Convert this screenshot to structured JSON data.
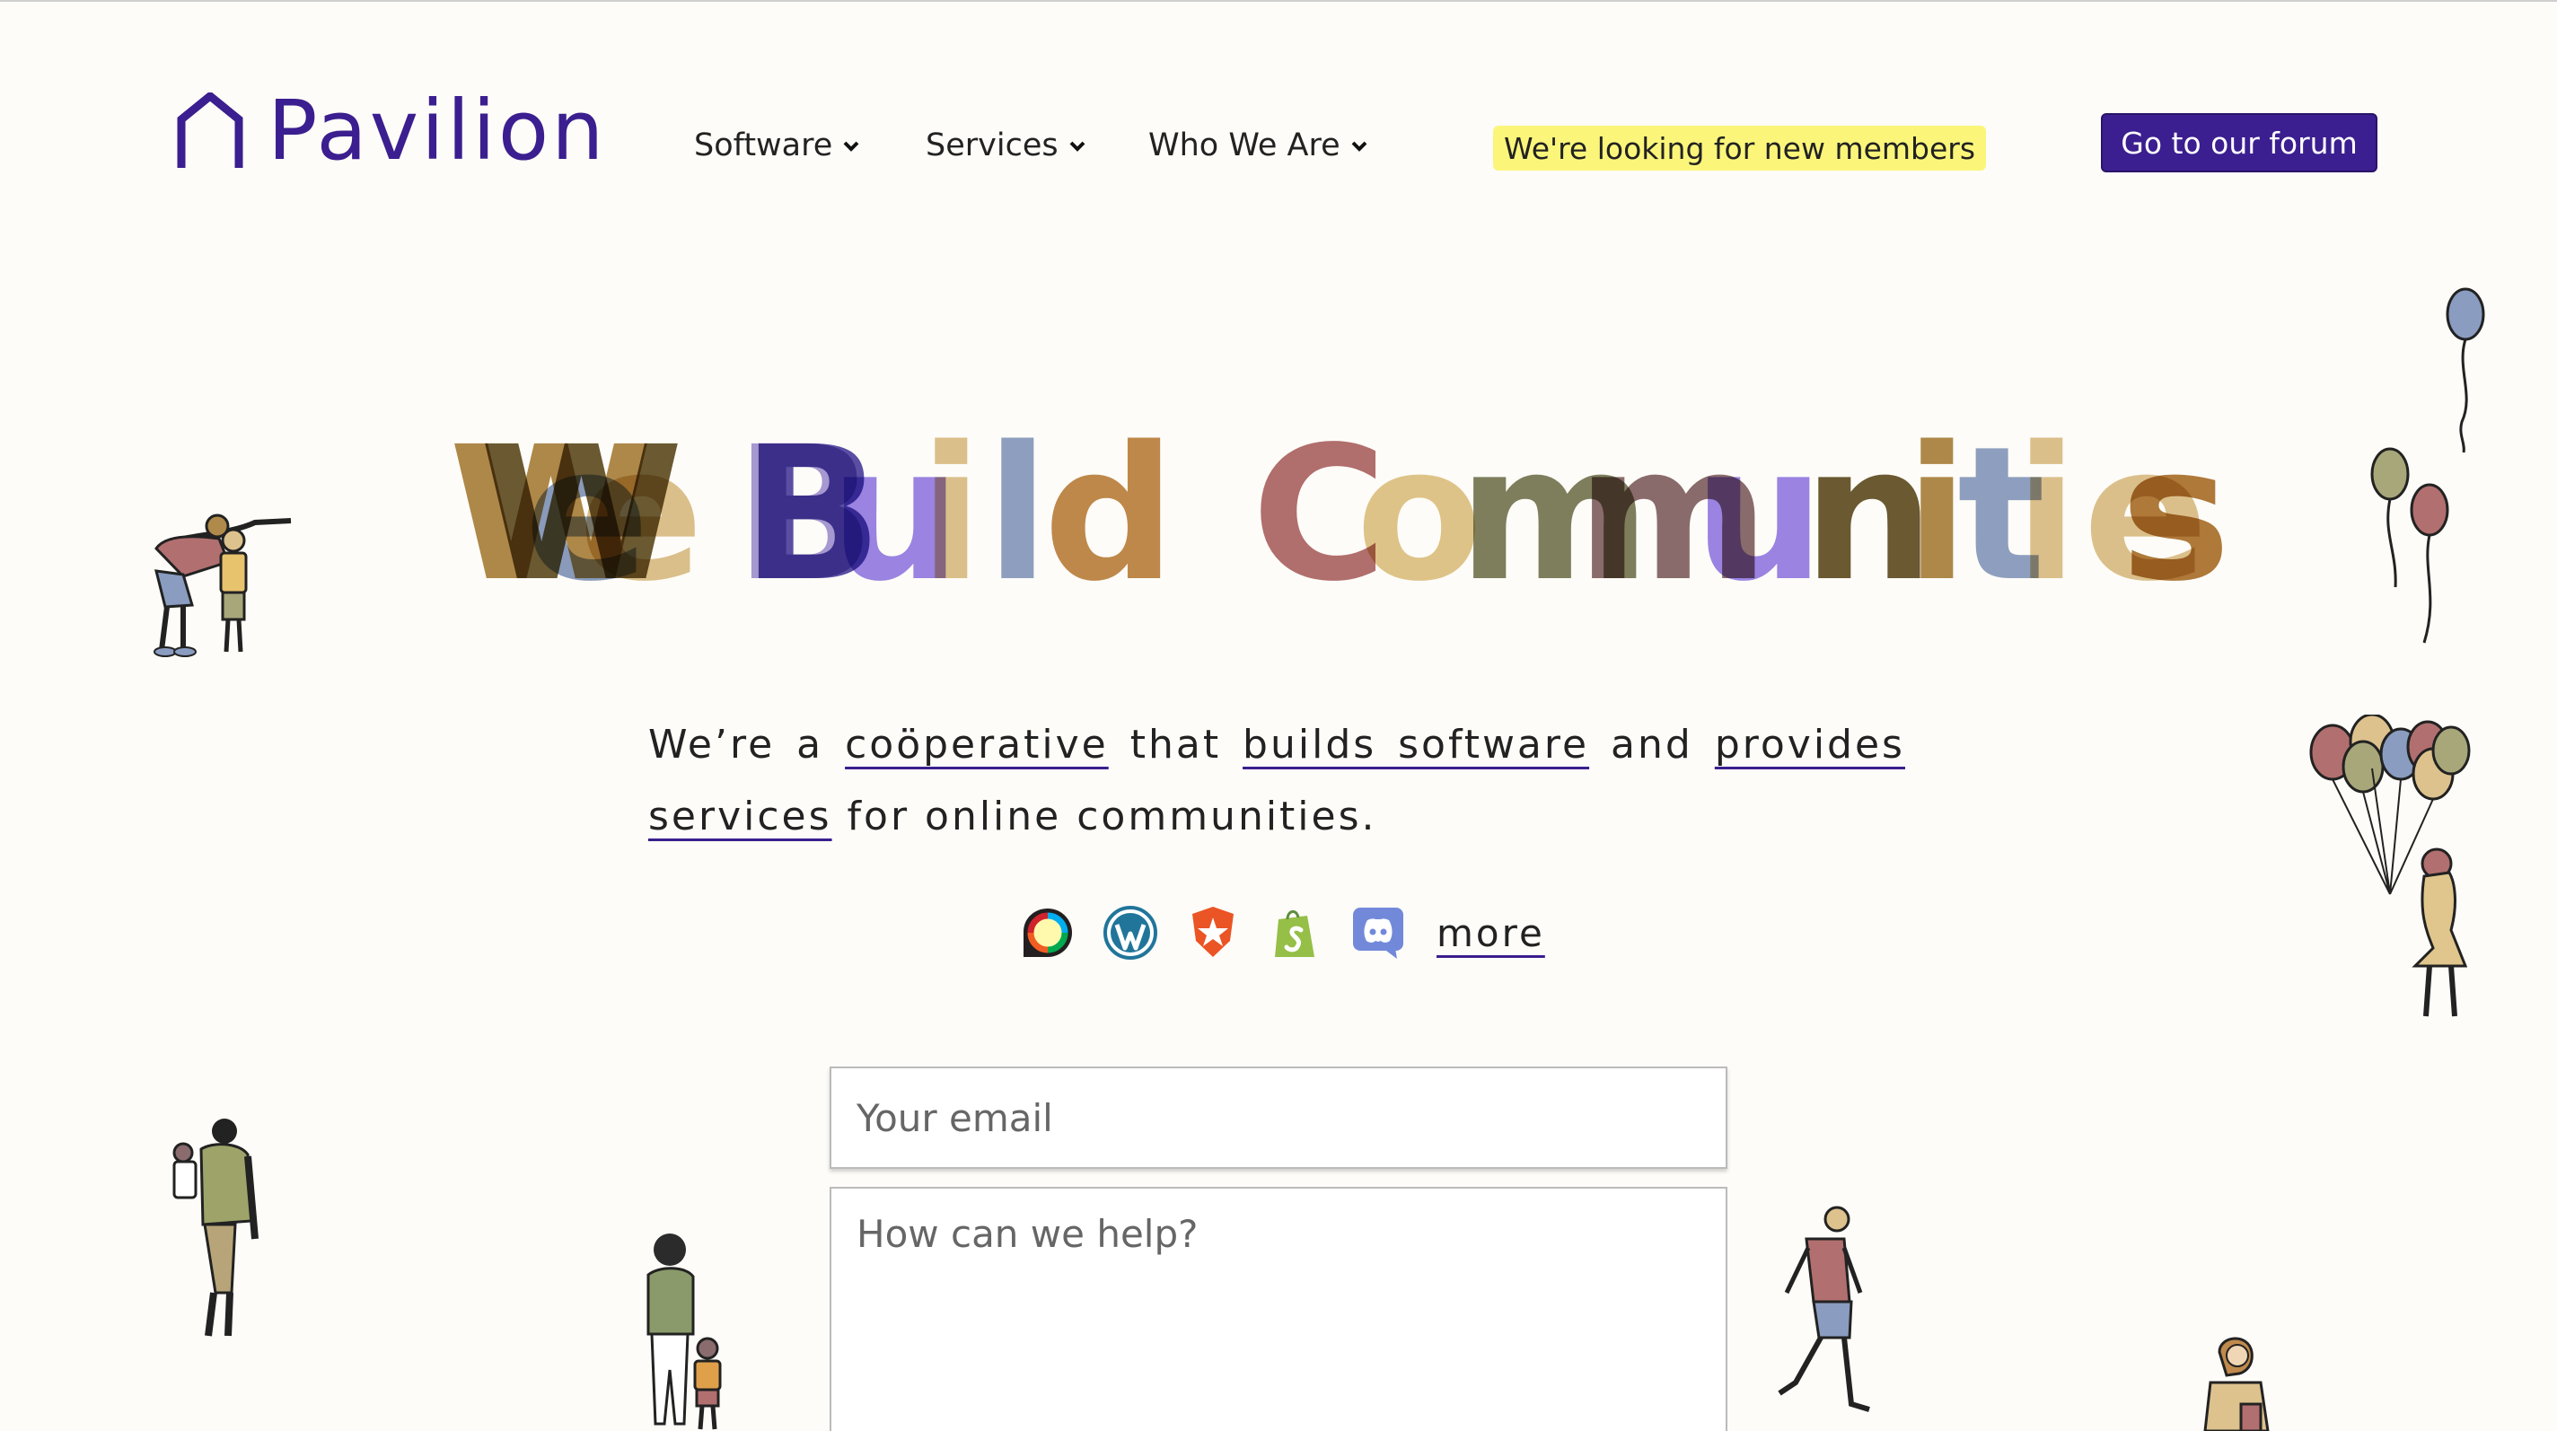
{
  "brand": {
    "name": "Pavilion",
    "color": "#3b1e8f"
  },
  "nav": [
    {
      "label": "Software"
    },
    {
      "label": "Services"
    },
    {
      "label": "Who We Are"
    }
  ],
  "badge": {
    "label": "We're looking for new members",
    "color": "#fbf67a"
  },
  "forum_button": {
    "label": "Go to our forum"
  },
  "headline": {
    "text": "We Build Communities",
    "letters": [
      {
        "ch": "W",
        "color": "#b08a4a"
      },
      {
        "ch": "W",
        "color": "#6b5a32"
      },
      {
        "ch": "e",
        "color": "#8a9cc0"
      },
      {
        "ch": "e",
        "color": "#ddc28e"
      },
      {
        "ch": "B",
        "color": "#a79ad6"
      },
      {
        "ch": "B",
        "color": "#5a4fa8"
      },
      {
        "ch": "u",
        "color": "#9b85e8"
      },
      {
        "ch": "i",
        "color": "#ddc28e"
      },
      {
        "ch": "l",
        "color": "#8fa0c4"
      },
      {
        "ch": "d",
        "color": "#c08a4c"
      },
      {
        "ch": "C",
        "color": "#b26f6f"
      },
      {
        "ch": "o",
        "color": "#e0c68c"
      },
      {
        "ch": "m",
        "color": "#7f8060"
      },
      {
        "ch": "m",
        "color": "#8a6c6e"
      },
      {
        "ch": "u",
        "color": "#9b85e8"
      },
      {
        "ch": "n",
        "color": "#6b5a32"
      },
      {
        "ch": "i",
        "color": "#b08a4a"
      },
      {
        "ch": "t",
        "color": "#8fa0c4"
      },
      {
        "ch": "i",
        "color": "#ddc28e"
      },
      {
        "ch": "e",
        "color": "#ddc28e"
      },
      {
        "ch": "s",
        "color": "#b07a3a"
      }
    ]
  },
  "tagline": {
    "p1": "We’re a ",
    "link1": "coöperative",
    "p2": " that ",
    "link2": "builds software",
    "p3": " and ",
    "link3": "provides services",
    "p4": " for online communities."
  },
  "platforms": {
    "icons": [
      "discourse-icon",
      "wordpress-icon",
      "auth0-icon",
      "shopify-icon",
      "discord-icon"
    ],
    "more_label": "more"
  },
  "form": {
    "email_placeholder": "Your email",
    "help_placeholder": "How can we help?"
  }
}
